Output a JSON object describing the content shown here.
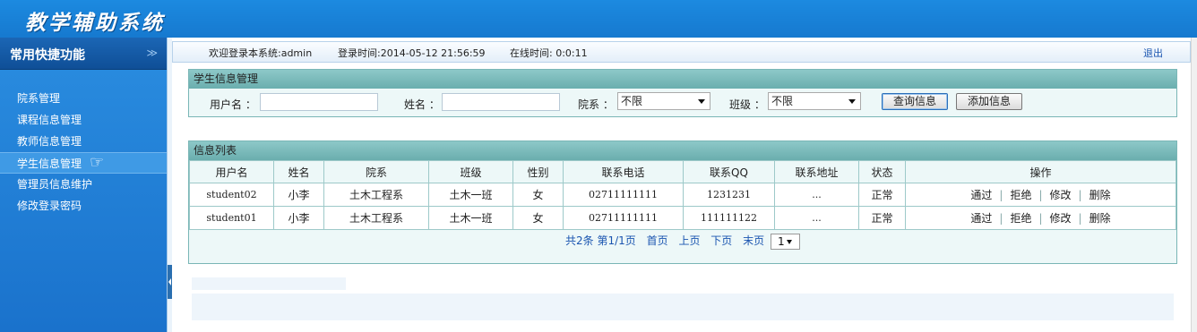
{
  "app": {
    "title": "教学辅助系统"
  },
  "sidebar": {
    "title": "常用快捷功能",
    "collapse_icon": "double-chevron-down-icon",
    "items": [
      {
        "label": "院系管理",
        "active": false
      },
      {
        "label": "课程信息管理",
        "active": false
      },
      {
        "label": "教师信息管理",
        "active": false
      },
      {
        "label": "学生信息管理",
        "active": true
      },
      {
        "label": "管理员信息维护",
        "active": false
      },
      {
        "label": "修改登录密码",
        "active": false
      }
    ]
  },
  "topbar": {
    "welcome": "欢迎登录本系统:admin",
    "login_time": "登录时间:2014-05-12 21:56:59",
    "online_time": "在线时间: 0:0:11",
    "logout": "退出"
  },
  "search_panel": {
    "title": "学生信息管理",
    "username_label": "用户名 ：",
    "name_label": "姓名 ：",
    "department_label": "院系 ：",
    "department_value": "不限",
    "class_label": "班级 ：",
    "class_value": "不限",
    "query_button": "查询信息",
    "add_button": "添加信息"
  },
  "list_panel": {
    "title": "信息列表",
    "columns": [
      "用户名",
      "姓名",
      "院系",
      "班级",
      "性别",
      "联系电话",
      "联系QQ",
      "联系地址",
      "状态",
      "操作"
    ],
    "rows": [
      {
        "username": "student02",
        "name": "小李",
        "department": "土木工程系",
        "class": "土木一班",
        "gender": "女",
        "phone": "02711111111",
        "qq": "1231231",
        "address": "...",
        "status": "正常"
      },
      {
        "username": "student01",
        "name": "小李",
        "department": "土木工程系",
        "class": "土木一班",
        "gender": "女",
        "phone": "02711111111",
        "qq": "111111122",
        "address": "...",
        "status": "正常"
      }
    ],
    "actions": {
      "approve": "通过",
      "reject": "拒绝",
      "edit": "修改",
      "delete": "删除",
      "separator": "|"
    },
    "pager": {
      "summary": "共2条 第1/1页",
      "first": "首页",
      "prev": "上页",
      "next": "下页",
      "last": "末页",
      "page_select": "1"
    }
  }
}
